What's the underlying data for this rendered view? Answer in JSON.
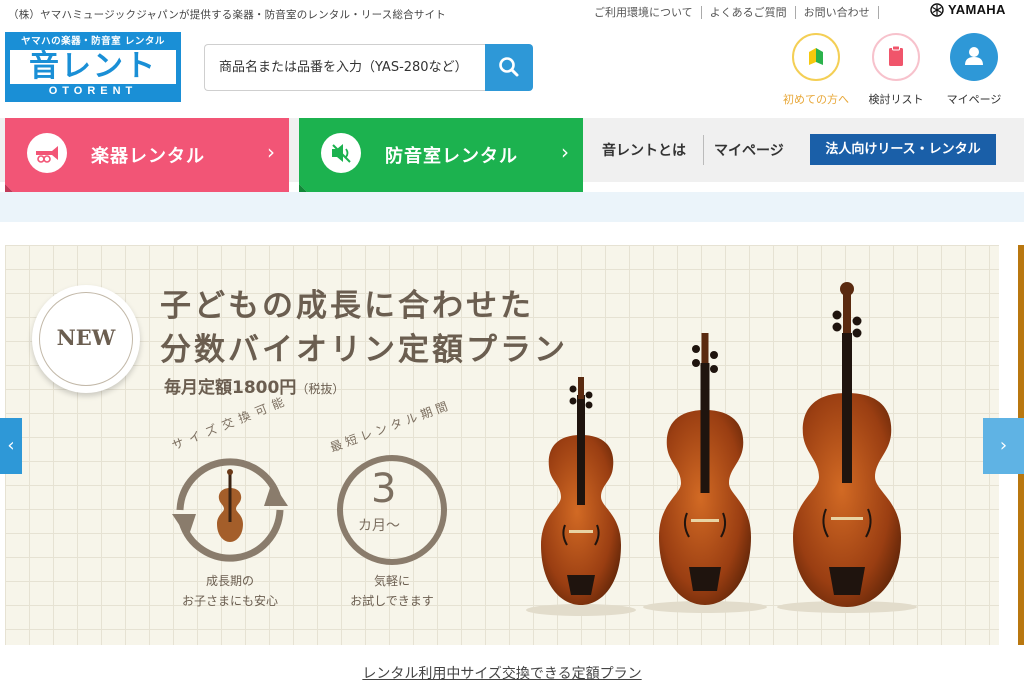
{
  "header": {
    "tagline": "（株）ヤマハミュージックジャパンが提供する楽器・防音室のレンタル・リース総合サイト",
    "links": [
      "ご利用環境について",
      "よくあるご質問",
      "お問い合わせ"
    ],
    "brand": "YAMAHA"
  },
  "logo": {
    "subtitle": "ヤマハの楽器・防音室 レンタル",
    "name": "音レント",
    "english": "OTORENT"
  },
  "search": {
    "placeholder": "商品名または品番を入力（YAS-280など）",
    "value": ""
  },
  "header_icons": [
    {
      "label": "初めての方へ",
      "icon": "beginner-icon",
      "color": "#e8a83a"
    },
    {
      "label": "検討リスト",
      "icon": "clipboard-icon",
      "color": "#f0556b"
    },
    {
      "label": "マイページ",
      "icon": "user-icon",
      "color": "#2e98d7"
    }
  ],
  "nav": {
    "instrument": "楽器レンタル",
    "soundproof": "防音室レンタル",
    "about": "音レントとは",
    "mypage": "マイページ",
    "corporate": "法人向けリース・レンタル",
    "colors": {
      "instrument": "#f25576",
      "soundproof": "#1cb24f",
      "corporate": "#1a5fa8"
    }
  },
  "hero": {
    "badge": "NEW",
    "title_line1": "子どもの成長に合わせた",
    "title_line2": "分数バイオリン定額プラン",
    "price_main": "毎月定額1800円",
    "price_tax": "（税抜）",
    "size_exchange": "サイズ交換可能",
    "size_caption_1": "成長期の",
    "size_caption_2": "お子さまにも安心",
    "min_period": "最短レンタル期間",
    "min_number": "3",
    "min_unit": "カ月〜",
    "trial_caption_1": "気軽に",
    "trial_caption_2": "お試しできます"
  },
  "carousel": {
    "prev": "‹",
    "next": "›"
  },
  "bottom_link": "レンタル利用中サイズ交換できる定額プラン"
}
